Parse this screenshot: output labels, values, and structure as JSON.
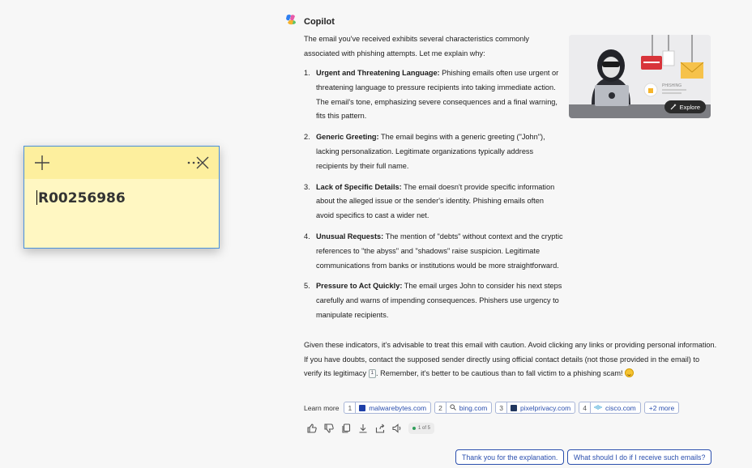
{
  "sticky": {
    "text": "R00256986",
    "add_icon": "plus-icon",
    "menu_icon": "more-icon",
    "close_icon": "close-icon"
  },
  "copilot": {
    "name": "Copilot",
    "intro": "The email you've received exhibits several characteristics commonly associated with phishing attempts. Let me explain why:",
    "points": [
      {
        "num": "1.",
        "title": "Urgent and Threatening Language:",
        "text": " Phishing emails often use urgent or threatening language to pressure recipients into taking immediate action. The email's tone, emphasizing severe consequences and a final warning, fits this pattern."
      },
      {
        "num": "2.",
        "title": "Generic Greeting:",
        "text": " The email begins with a generic greeting (\"John\"), lacking personalization. Legitimate organizations typically address recipients by their full name."
      },
      {
        "num": "3.",
        "title": "Lack of Specific Details:",
        "text": " The email doesn't provide specific information about the alleged issue or the sender's identity. Phishing emails often avoid specifics to cast a wider net."
      },
      {
        "num": "4.",
        "title": "Unusual Requests:",
        "text": " The mention of \"debts\" without context and the cryptic references to \"the abyss\" and \"shadows\" raise suspicion. Legitimate communications from banks or institutions would be more straightforward."
      },
      {
        "num": "5.",
        "title": "Pressure to Act Quickly:",
        "text": " The email urges John to consider his next steps carefully and warns of impending consequences. Phishers use urgency to manipulate recipients."
      }
    ],
    "conclusion_a": "Given these indicators, it's advisable to treat this email with caution. Avoid clicking any links or providing personal information. If you have doubts, contact the supposed sender directly using official contact details (not those provided in the email) to verify its legitimacy",
    "conclusion_cite": "1",
    "conclusion_b": ". Remember, it's better to be cautious than to fall victim to a phishing scam!",
    "image": {
      "explore_label": "Explore",
      "phishing_word": "PHISHING"
    },
    "learn_more": {
      "label": "Learn more",
      "sources": [
        {
          "num": "1",
          "site": "malwarebytes.com",
          "color": "#1d3ea8"
        },
        {
          "num": "2",
          "site": "bing.com",
          "color": "#666666"
        },
        {
          "num": "3",
          "site": "pixelprivacy.com",
          "color": "#20365e"
        },
        {
          "num": "4",
          "site": "cisco.com",
          "color": "#3aa6d6"
        }
      ],
      "more": "+2 more"
    },
    "pager": "1 of 5",
    "suggestions": [
      "Thank you for the explanation.",
      "What should I do if I receive such emails?"
    ]
  }
}
